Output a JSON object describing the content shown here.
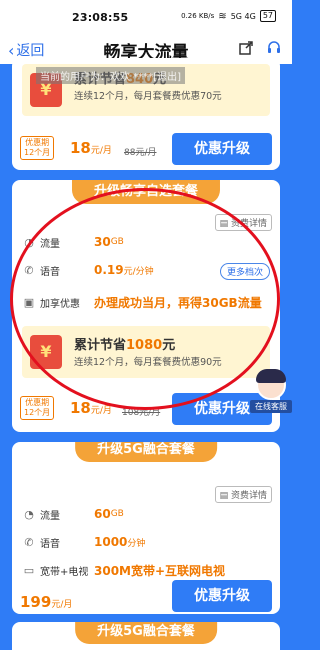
{
  "status_bar": {
    "time": "23:08:55",
    "network_speed": "0.26 KB/s",
    "signal": "5G 4G",
    "battery": "57"
  },
  "nav": {
    "back_label": "返回",
    "title": "畅享大流量"
  },
  "overlay": {
    "text": "当前的用户为：欢欢 ****[退出]"
  },
  "card1": {
    "saving_title": "累计节省",
    "saving_amount": "840",
    "saving_unit": "元",
    "saving_sub": "连续12个月，每月套餐费优惠70元",
    "period_line1": "优惠期",
    "period_line2": "12个月",
    "price": "18",
    "price_unit": "元/月",
    "orig_price": "88元/月",
    "upgrade_label": "优惠升级"
  },
  "card2": {
    "banner": "升级畅享自选套餐",
    "detail_label": "资费详情",
    "rows": [
      {
        "icon": "data-icon",
        "label": "流量",
        "value": "30",
        "unit": "GB"
      },
      {
        "icon": "voice-icon",
        "label": "语音",
        "value": "0.19",
        "unit": "元/分钟"
      },
      {
        "icon": "gift-icon",
        "label": "加享优惠",
        "value": "办理成功当月，再得30GB流量",
        "unit": ""
      }
    ],
    "more_label": "更多档次",
    "saving_title": "累计节省",
    "saving_amount": "1080",
    "saving_unit": "元",
    "saving_sub": "连续12个月，每月套餐费优惠90元",
    "period_line1": "优惠期",
    "period_line2": "12个月",
    "price": "18",
    "price_unit": "元/月",
    "orig_price": "108元/月",
    "upgrade_label": "优惠升级"
  },
  "card3": {
    "banner": "升级5G融合套餐",
    "detail_label": "资费详情",
    "rows": [
      {
        "icon": "data-icon",
        "label": "流量",
        "value": "60",
        "unit": "GB"
      },
      {
        "icon": "voice-icon",
        "label": "语音",
        "value": "1000",
        "unit": "分钟"
      },
      {
        "icon": "tv-icon",
        "label": "宽带+电视",
        "value": "300M宽带+互联网电视",
        "unit": ""
      }
    ],
    "price": "199",
    "price_unit": "元/月",
    "upgrade_label": "优惠升级"
  },
  "card4": {
    "banner": "升级5G融合套餐"
  },
  "customer_service": {
    "label": "在线客服"
  },
  "bag_symbol": "¥"
}
